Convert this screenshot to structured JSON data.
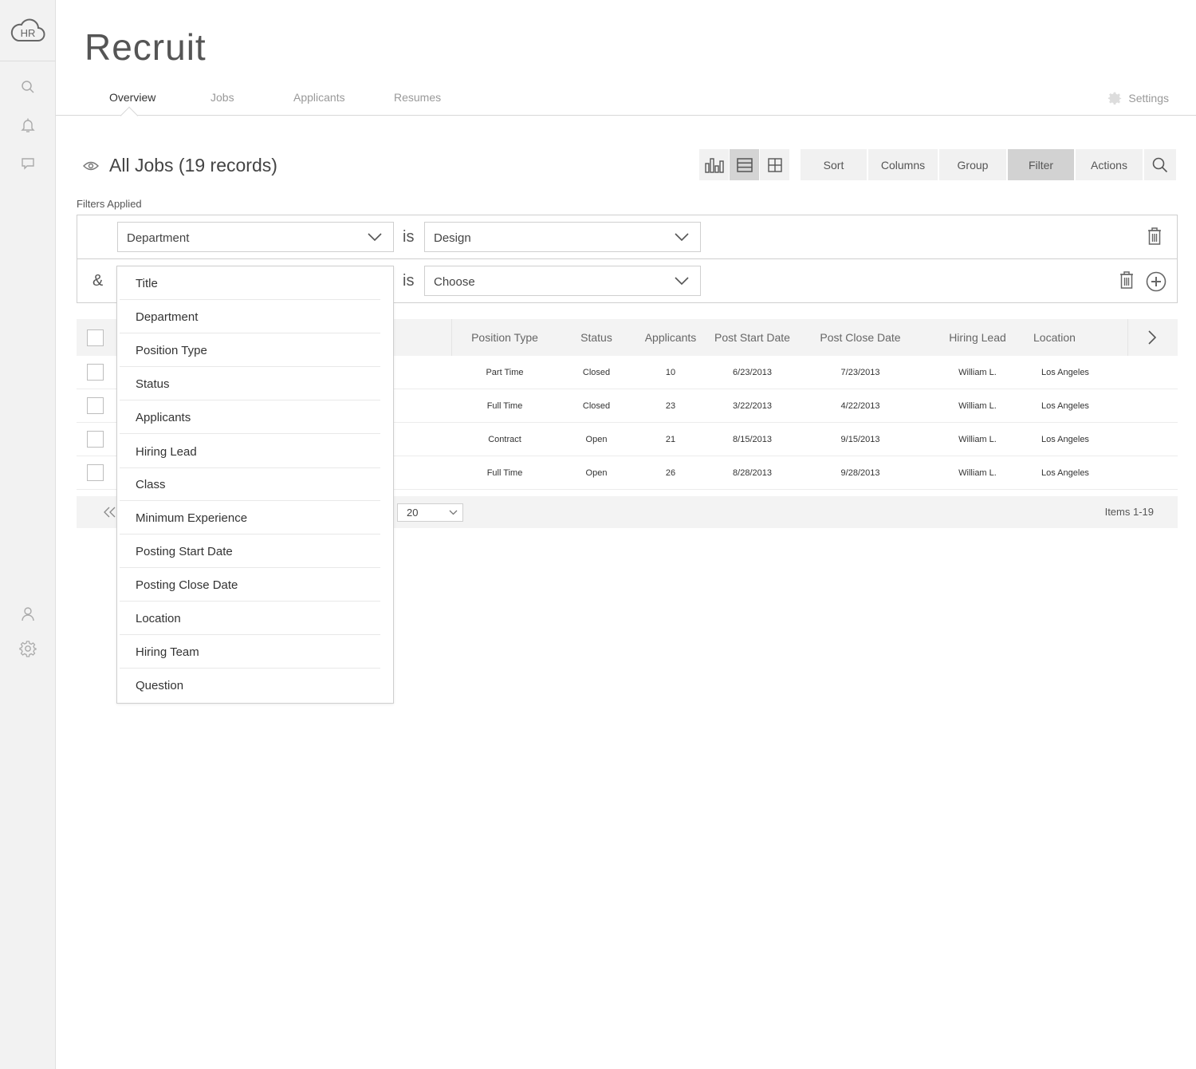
{
  "app": {
    "title": "Recruit",
    "logo_text": "HR"
  },
  "rail": {
    "icons": [
      "search-icon",
      "bell-icon",
      "chat-icon",
      "user-icon",
      "gear-icon"
    ]
  },
  "tabs": [
    {
      "label": "Overview",
      "active": true
    },
    {
      "label": "Jobs",
      "active": false
    },
    {
      "label": "Applicants",
      "active": false
    },
    {
      "label": "Resumes",
      "active": false
    }
  ],
  "settings_label": "Settings",
  "view": {
    "title": "All Jobs (19 records)"
  },
  "toolbar": {
    "sort": "Sort",
    "columns": "Columns",
    "group": "Group",
    "filter": "Filter",
    "actions": "Actions"
  },
  "filters": {
    "label": "Filters Applied",
    "rows": [
      {
        "field": "Department",
        "operator": "is",
        "value": "Design"
      },
      {
        "conjunction": "&",
        "field": "",
        "operator": "is",
        "value": "Choose"
      }
    ]
  },
  "dropdown_options": [
    "Title",
    "Department",
    "Position Type",
    "Status",
    "Applicants",
    "Hiring Lead",
    "Class",
    "Minimum Experience",
    "Posting Start Date",
    "Posting Close Date",
    "Location",
    "Hiring Team",
    "Question"
  ],
  "table": {
    "columns": [
      "Position Type",
      "Status",
      "Applicants",
      "Post Start Date",
      "Post Close Date",
      "Hiring Lead",
      "Location"
    ],
    "rows": [
      [
        "Part Time",
        "Closed",
        "10",
        "6/23/2013",
        "7/23/2013",
        "William L.",
        "Los Angeles"
      ],
      [
        "Full Time",
        "Closed",
        "23",
        "3/22/2013",
        "4/22/2013",
        "William L.",
        "Los Angeles"
      ],
      [
        "Contract",
        "Open",
        "21",
        "8/15/2013",
        "9/15/2013",
        "William L.",
        "Los Angeles"
      ],
      [
        "Full Time",
        "Open",
        "26",
        "8/28/2013",
        "9/28/2013",
        "William L.",
        "Los Angeles"
      ]
    ]
  },
  "pager": {
    "per_page": "20",
    "items": "Items 1-19"
  },
  "colors": {
    "accent_active": "#d2d2d2",
    "rail_bg": "#f2f2f2"
  }
}
